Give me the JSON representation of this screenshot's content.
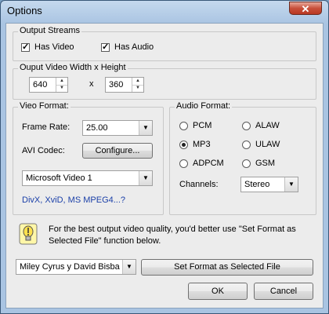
{
  "window": {
    "title": "Options",
    "close_glyph": "✕"
  },
  "output_streams": {
    "label": "Output Streams",
    "has_video": {
      "label": "Has Video",
      "checked": true
    },
    "has_audio": {
      "label": "Has Audio",
      "checked": true
    }
  },
  "video_size": {
    "label": "Ouput Video Width x Height",
    "width": "640",
    "separator": "x",
    "height": "360"
  },
  "video_format": {
    "label": "Vieo Format:",
    "frame_rate_label": "Frame Rate:",
    "frame_rate_value": "25.00",
    "codec_label": "AVI Codec:",
    "configure_label": "Configure...",
    "codec_value": "Microsoft Video 1",
    "codec_link": "DivX, XviD, MS MPEG4...?"
  },
  "audio_format": {
    "label": "Audio Format:",
    "options": [
      "PCM",
      "ALAW",
      "MP3",
      "ULAW",
      "ADPCM",
      "GSM"
    ],
    "selected": "MP3",
    "channels_label": "Channels:",
    "channels_value": "Stereo"
  },
  "tip": {
    "text_line1": "For the best output video quality, you'd better use \"Set Format as",
    "text_line2": "Selected File\" function below.",
    "icon": "lightbulb-icon"
  },
  "file_select": {
    "value": "Miley Cyrus y David Bisba"
  },
  "buttons": {
    "set_format": "Set Format as Selected File",
    "ok": "OK",
    "cancel": "Cancel"
  }
}
